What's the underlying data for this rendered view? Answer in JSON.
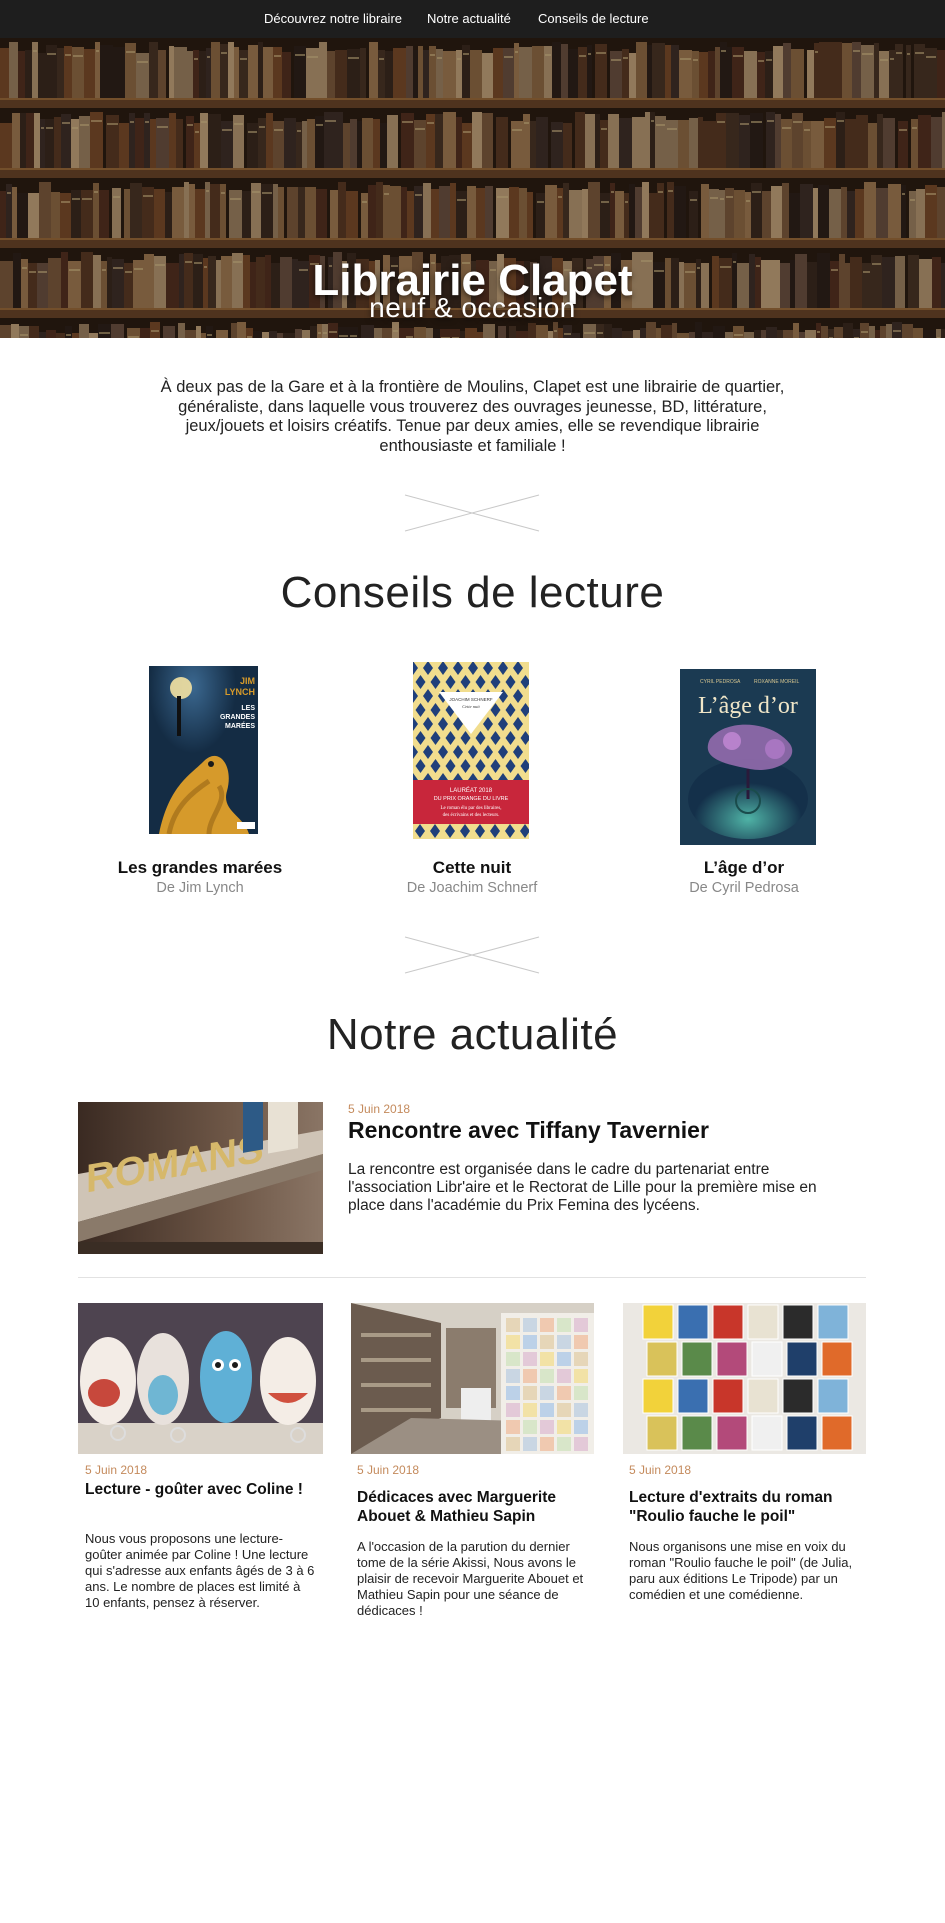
{
  "nav": {
    "items": [
      "Découvrez notre libraire",
      "Notre actualité",
      "Conseils de lecture"
    ]
  },
  "hero": {
    "title": "Librairie Clapet",
    "subtitle": "neuf & occasion"
  },
  "intro": {
    "text": "À deux pas de la Gare et à la frontière de Moulins, Clapet est une librairie de quartier, généraliste, dans laquelle vous trouverez des ouvrages jeunesse, BD, littérature, jeux/jouets et loisirs créatifs. Tenue par deux amies, elle se revendique librairie enthousiaste et familiale !"
  },
  "reading": {
    "heading": "Conseils de lecture",
    "books": [
      {
        "title": "Les grandes marées",
        "author": "De Jim Lynch",
        "cover_text": [
          "JIM",
          "LYNCH",
          "LES",
          "GRANDES",
          "MARÉES"
        ],
        "colors": {
          "bg": "#1f3d5c",
          "accent": "#d69a2b"
        }
      },
      {
        "title": "Cette nuit",
        "author": "De Joachim Schnerf",
        "cover_text": [
          "JOACHIM SCHNERF",
          "Cette nuit",
          "LAURÉAT 2018",
          "DU PRIX ORANGE DU LIVRE",
          "Le roman élu par des libraires,",
          "des écrivains et des lecteurs."
        ],
        "colors": {
          "bg": "#f1dd8e",
          "accent": "#1f3f7a",
          "band": "#c8263b"
        }
      },
      {
        "title": "L’âge d’or",
        "author": "De Cyril Pedrosa",
        "cover_text": [
          "CYRIL PEDROSA",
          "ROXANNE MOREIL",
          "L’âge d’or"
        ],
        "colors": {
          "bg": "#1b3a52",
          "accent": "#2e8b86"
        }
      }
    ]
  },
  "news": {
    "heading": "Notre actualité",
    "featured": {
      "date": "5 Juin 2018",
      "title": "Rencontre avec Tiffany Tavernier",
      "text": "La rencontre est organisée dans le cadre du partenariat entre l'association Libr'aire et le Rectorat de Lille pour la première mise en place dans l'académie du Prix Femina des lycéens.",
      "photo_text": "ROMANS"
    },
    "cards": [
      {
        "date": "5 Juin 2018",
        "title": "Lecture - goûter avec Coline !",
        "text": "Nous vous proposons une lecture-goûter animée par Coline ! Une lecture qui s'adresse aux enfants âgés de 3 à 6 ans. Le nombre de places est limité à 10 enfants, pensez à réserver."
      },
      {
        "date": "5 Juin 2018",
        "title": "Dédicaces avec Marguerite Abouet & Mathieu Sapin",
        "text": "A l'occasion de la parution du dernier tome de la série Akissi, Nous avons le plaisir de recevoir Marguerite Abouet et Mathieu Sapin pour une séance de dédicaces !"
      },
      {
        "date": "5 Juin 2018",
        "title": "Lecture d'extraits du roman \"Roulio fauche le poil\"",
        "text": "Nous organisons une mise en voix du roman \"Roulio fauche le poil\" (de Julia, paru aux éditions Le Tripode) par un comédien et une comédienne."
      }
    ]
  },
  "colors": {
    "nav_bg": "#1e1e1e",
    "date": "#c48a5c",
    "divider": "#c9c9c9"
  }
}
